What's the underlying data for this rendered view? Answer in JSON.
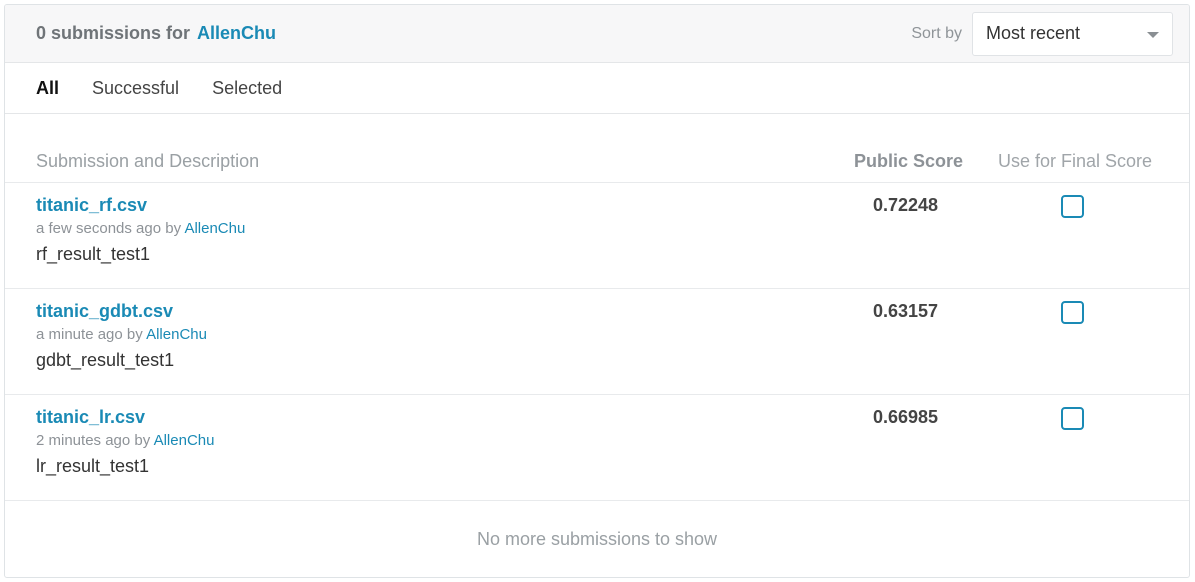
{
  "header": {
    "count_text": "0 submissions for",
    "user": "AllenChu",
    "sort_label": "Sort by",
    "sort_value": "Most recent"
  },
  "tabs": [
    {
      "label": "All",
      "active": true
    },
    {
      "label": "Successful",
      "active": false
    },
    {
      "label": "Selected",
      "active": false
    }
  ],
  "columns": {
    "description": "Submission and Description",
    "score": "Public Score",
    "final": "Use for Final Score"
  },
  "submissions": [
    {
      "file": "titanic_rf.csv",
      "time": "a few seconds ago",
      "by": "by",
      "user": "AllenChu",
      "description": "rf_result_test1",
      "score": "0.72248",
      "selected": false
    },
    {
      "file": "titanic_gdbt.csv",
      "time": "a minute ago",
      "by": "by",
      "user": "AllenChu",
      "description": "gdbt_result_test1",
      "score": "0.63157",
      "selected": false
    },
    {
      "file": "titanic_lr.csv",
      "time": "2 minutes ago",
      "by": "by",
      "user": "AllenChu",
      "description": "lr_result_test1",
      "score": "0.66985",
      "selected": false
    }
  ],
  "footer": {
    "text": "No more submissions to show"
  },
  "colors": {
    "accent": "#1a8ab5",
    "muted": "#8d9297"
  }
}
